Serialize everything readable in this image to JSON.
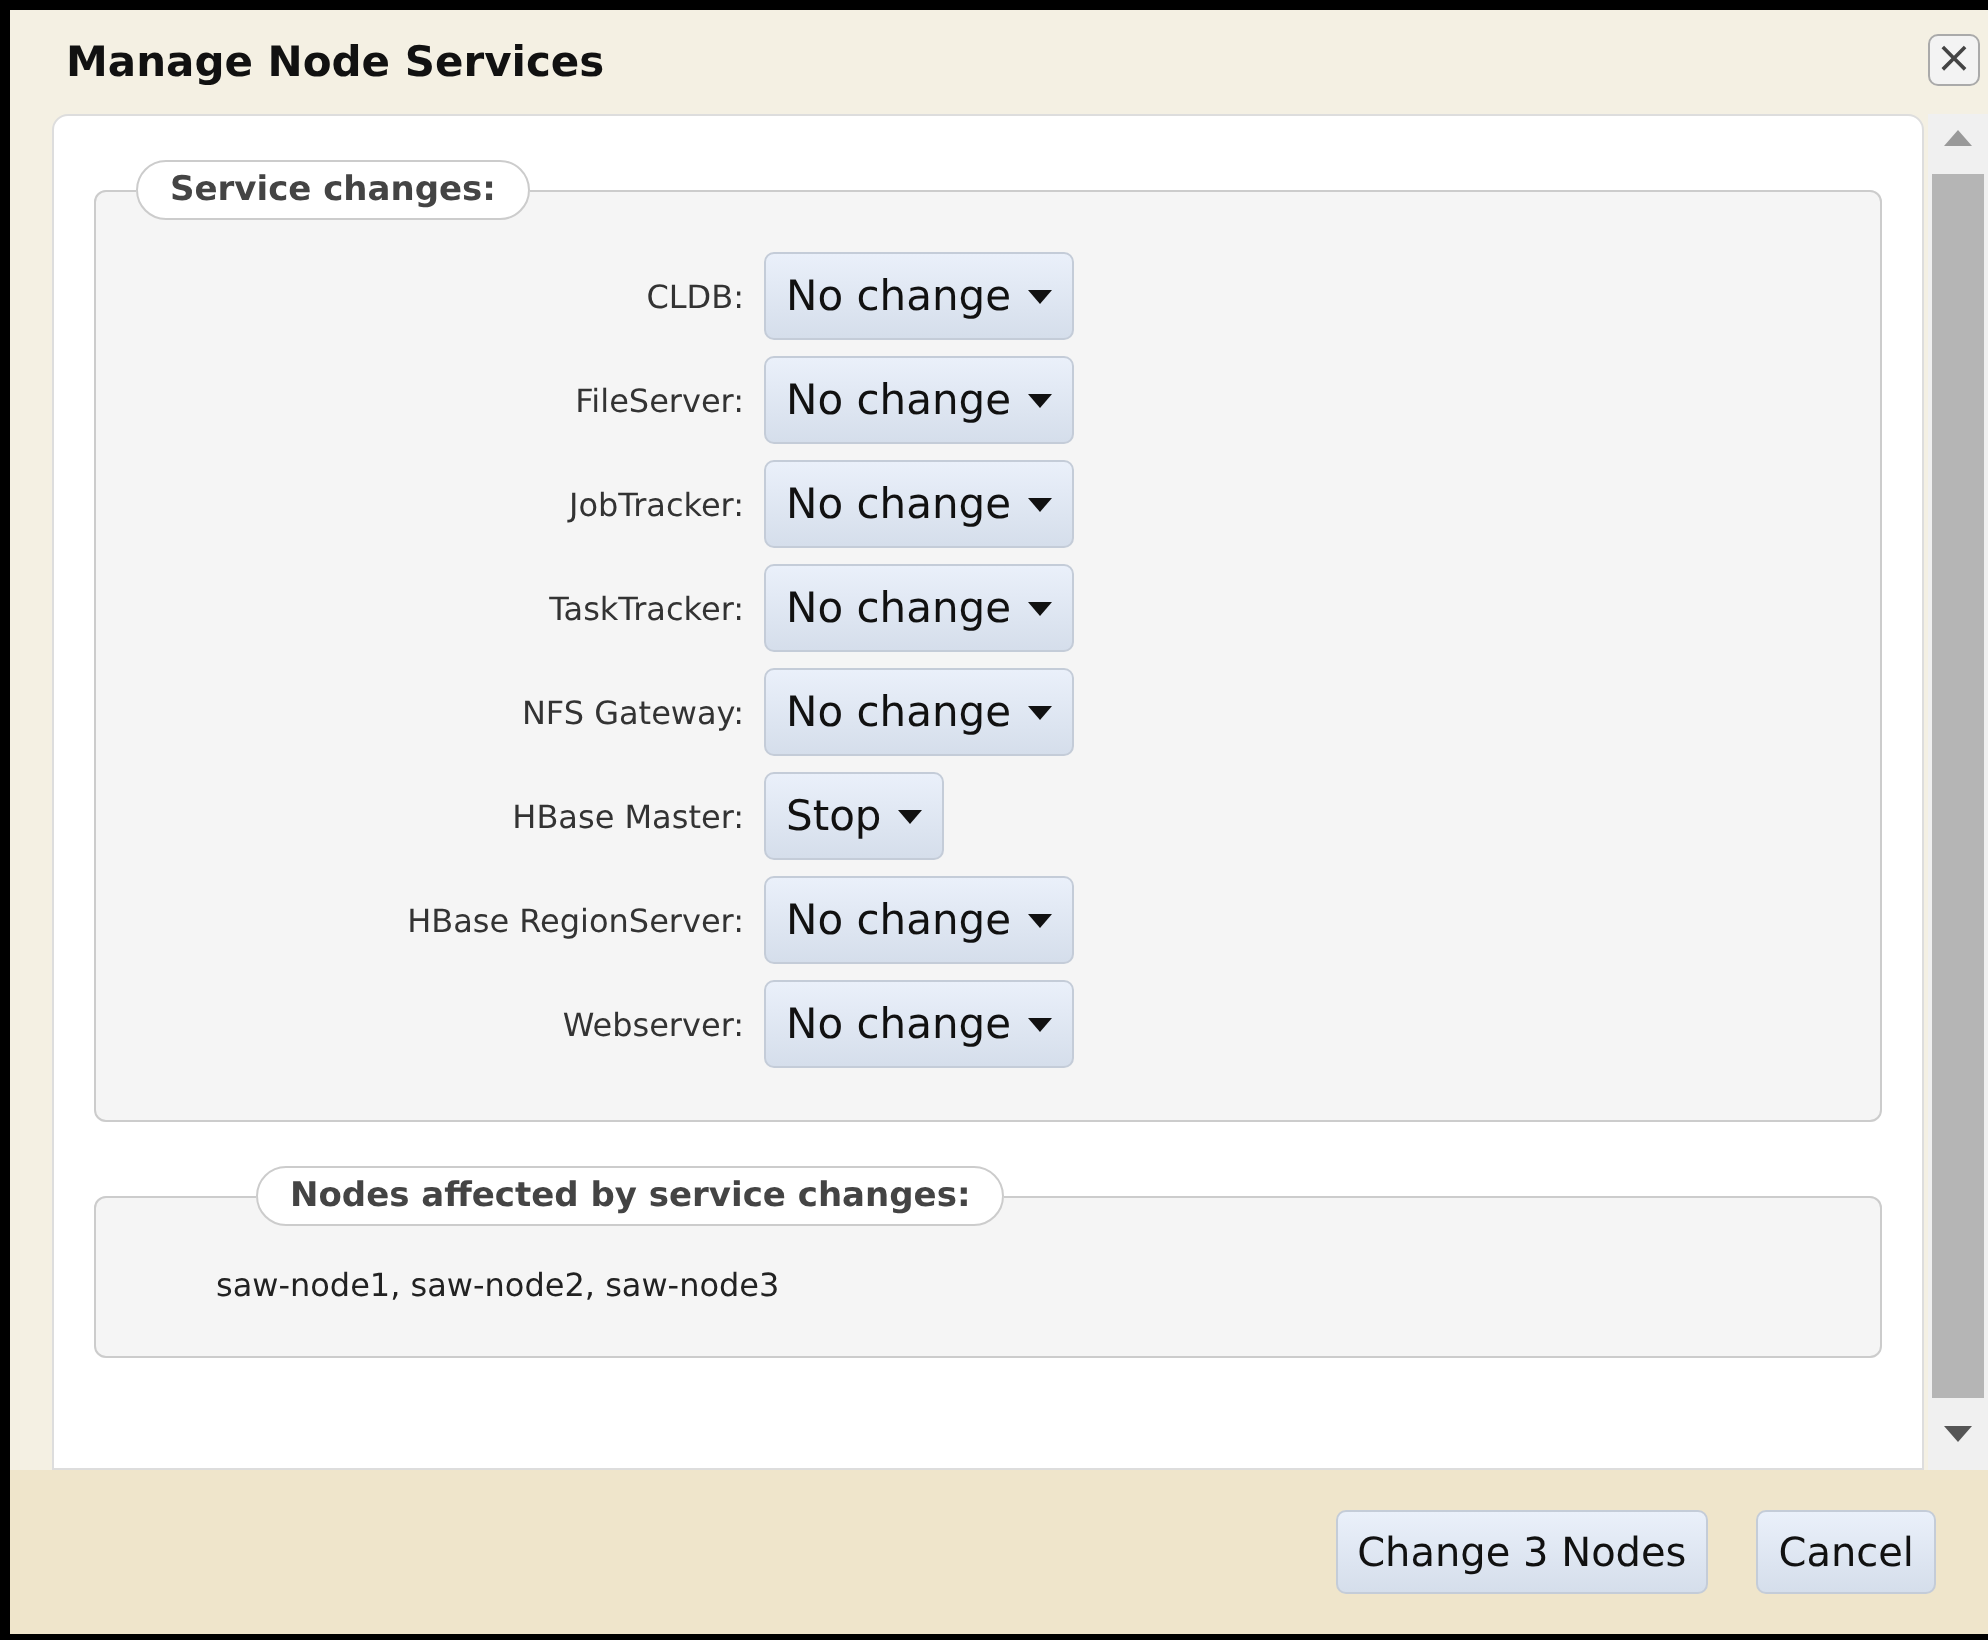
{
  "window": {
    "title": "Manage Node Services",
    "close": "×"
  },
  "service_changes": {
    "legend": "Service changes:",
    "rows": [
      {
        "label": "CLDB:",
        "value": "No change"
      },
      {
        "label": "FileServer:",
        "value": "No change"
      },
      {
        "label": "JobTracker:",
        "value": "No change"
      },
      {
        "label": "TaskTracker:",
        "value": "No change"
      },
      {
        "label": "NFS Gateway:",
        "value": "No change"
      },
      {
        "label": "HBase Master:",
        "value": "Stop"
      },
      {
        "label": "HBase RegionServer:",
        "value": "No change"
      },
      {
        "label": "Webserver:",
        "value": "No change"
      }
    ]
  },
  "nodes_affected": {
    "legend": "Nodes affected by service changes:",
    "text": "saw-node1, saw-node2, saw-node3"
  },
  "buttons": [
    "Change 3 Nodes",
    "Cancel"
  ]
}
